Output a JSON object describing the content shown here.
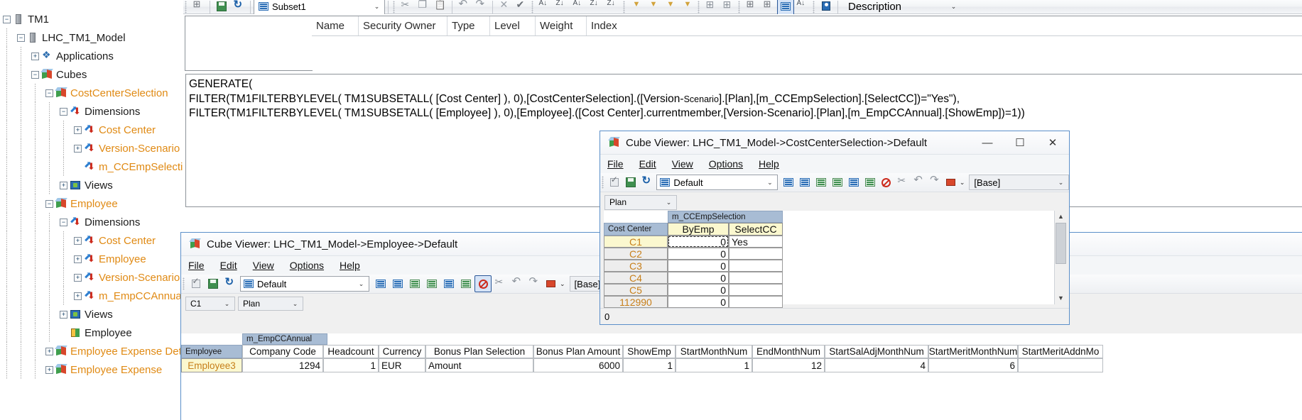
{
  "tree": {
    "items": [
      {
        "label": "TM1",
        "indent": 0,
        "expander": "minus",
        "icon": "server",
        "color": "dark"
      },
      {
        "label": "LHC_TM1_Model",
        "indent": 1,
        "expander": "minus",
        "icon": "server",
        "color": "dark"
      },
      {
        "label": "Applications",
        "indent": 2,
        "expander": "plus",
        "icon": "apps",
        "color": "dark"
      },
      {
        "label": "Cubes",
        "indent": 2,
        "expander": "minus",
        "icon": "cube",
        "color": "dark"
      },
      {
        "label": "CostCenterSelection",
        "indent": 3,
        "expander": "minus",
        "icon": "cube",
        "color": "orange"
      },
      {
        "label": "Dimensions",
        "indent": 4,
        "expander": "minus",
        "icon": "dim",
        "color": "dark"
      },
      {
        "label": "Cost Center",
        "indent": 5,
        "expander": "plus",
        "icon": "dim",
        "color": "orange"
      },
      {
        "label": "Version-Scenario",
        "indent": 5,
        "expander": "plus",
        "icon": "dim",
        "color": "orange"
      },
      {
        "label": "m_CCEmpSelection",
        "indent": 5,
        "expander": "none",
        "icon": "dim",
        "color": "orange"
      },
      {
        "label": "Views",
        "indent": 4,
        "expander": "plus",
        "icon": "views",
        "color": "dark"
      },
      {
        "label": "Employee",
        "indent": 3,
        "expander": "minus",
        "icon": "cube",
        "color": "orange"
      },
      {
        "label": "Dimensions",
        "indent": 4,
        "expander": "minus",
        "icon": "dim",
        "color": "dark"
      },
      {
        "label": "Cost Center",
        "indent": 5,
        "expander": "plus",
        "icon": "dim",
        "color": "orange"
      },
      {
        "label": "Employee",
        "indent": 5,
        "expander": "plus",
        "icon": "dim",
        "color": "orange"
      },
      {
        "label": "Version-Scenario",
        "indent": 5,
        "expander": "plus",
        "icon": "dim",
        "color": "orange"
      },
      {
        "label": "m_EmpCCAnnual",
        "indent": 5,
        "expander": "plus",
        "icon": "dim",
        "color": "orange"
      },
      {
        "label": "Views",
        "indent": 4,
        "expander": "plus",
        "icon": "views",
        "color": "dark"
      },
      {
        "label": "Employee",
        "indent": 4,
        "expander": "none",
        "icon": "proc",
        "color": "dark"
      },
      {
        "label": "Employee Expense Detail",
        "indent": 3,
        "expander": "plus",
        "icon": "cube",
        "color": "orange"
      },
      {
        "label": "Employee Expense",
        "indent": 3,
        "expander": "plus",
        "icon": "cube",
        "color": "orange"
      }
    ]
  },
  "subset_editor": {
    "subset_name": "Subset1",
    "description_label": "Description",
    "columns": [
      "Name",
      "Security Owner",
      "Type",
      "Level",
      "Weight",
      "Index"
    ],
    "toolbar_icons": [
      "tree-icon",
      "save-icon",
      "refresh-icon",
      "subset-icon",
      "cut-icon",
      "copy-icon",
      "paste-icon",
      "undo-icon",
      "redo-icon",
      "delete-icon",
      "confirm-icon",
      "sort-ascending-icon",
      "sort-descending-icon",
      "sort-hierarchy-icon",
      "sort-index-ascending-icon",
      "sort-index-descending-icon",
      "filter-by-level-icon",
      "filter-by-attribute-icon",
      "filter-by-expression-icon",
      "filter-clear-icon",
      "insert-member-icon",
      "insert-calculation-icon",
      "expand-icon",
      "collapse-icon",
      "mdx-editor-icon",
      "drill-icon",
      "security-icon"
    ]
  },
  "mdx": {
    "line1": "GENERATE(",
    "line2_a": "FILTER(TM1FILTERBYLEVEL( TM1SUBSETALL( [Cost Center] ), 0),[CostCenterSelection].([Version-",
    "line2_small": "Scenario",
    "line2_b": "].[Plan],[m_CCEmpSelection].[SelectCC])=\"Yes\"),",
    "line3": "FILTER(TM1FILTERBYLEVEL( TM1SUBSETALL( [Employee] ), 0),[Employee].([Cost Center].currentmember,[Version-Scenario].[Plan],[m_EmpCCAnnual].[ShowEmp])=1))"
  },
  "cube_viewer_cc": {
    "title": "Cube Viewer: LHC_TM1_Model->CostCenterSelection->Default",
    "window_buttons": {
      "minimize": "—",
      "maximize": "☐",
      "close": "✕"
    },
    "menu": [
      "File",
      "Edit",
      "View",
      "Options",
      "Help"
    ],
    "view_name": "Default",
    "base_label": "[Base]",
    "context": {
      "version": "Plan"
    },
    "grid": {
      "dimension_header": "m_CCEmpSelection",
      "row_dimension": "Cost Center",
      "columns": [
        "ByEmp",
        "SelectCC"
      ],
      "rows": [
        {
          "name": "C1",
          "byemp": "0",
          "selectcc": "Yes",
          "selected": true
        },
        {
          "name": "C2",
          "byemp": "0",
          "selectcc": "",
          "selected": false
        },
        {
          "name": "C3",
          "byemp": "0",
          "selectcc": "",
          "selected": false
        },
        {
          "name": "C4",
          "byemp": "0",
          "selectcc": "",
          "selected": false
        },
        {
          "name": "C5",
          "byemp": "0",
          "selectcc": "",
          "selected": false
        },
        {
          "name": "112990",
          "byemp": "0",
          "selectcc": "",
          "selected": false
        }
      ]
    },
    "status": "0"
  },
  "cube_viewer_emp": {
    "title": "Cube Viewer: LHC_TM1_Model->Employee->Default",
    "menu": [
      "File",
      "Edit",
      "View",
      "Options",
      "Help"
    ],
    "view_name": "Default",
    "base_label": "[Base]",
    "context": {
      "cost_center": "C1",
      "version": "Plan"
    },
    "grid": {
      "dimension_header": "m_EmpCCAnnual",
      "row_dimension": "Employee",
      "columns": [
        "Company Code",
        "Headcount",
        "Currency",
        "Bonus Plan Selection",
        "Bonus Plan Amount",
        "ShowEmp",
        "StartMonthNum",
        "EndMonthNum",
        "StartSalAdjMonthNum",
        "StartMeritMonthNum",
        "StartMeritAddnMo"
      ],
      "rows": [
        {
          "name": "Employee3",
          "values": [
            "1294",
            "1",
            "EUR",
            "Amount",
            "6000",
            "1",
            "1",
            "12",
            "4",
            "6",
            ""
          ]
        }
      ]
    }
  }
}
